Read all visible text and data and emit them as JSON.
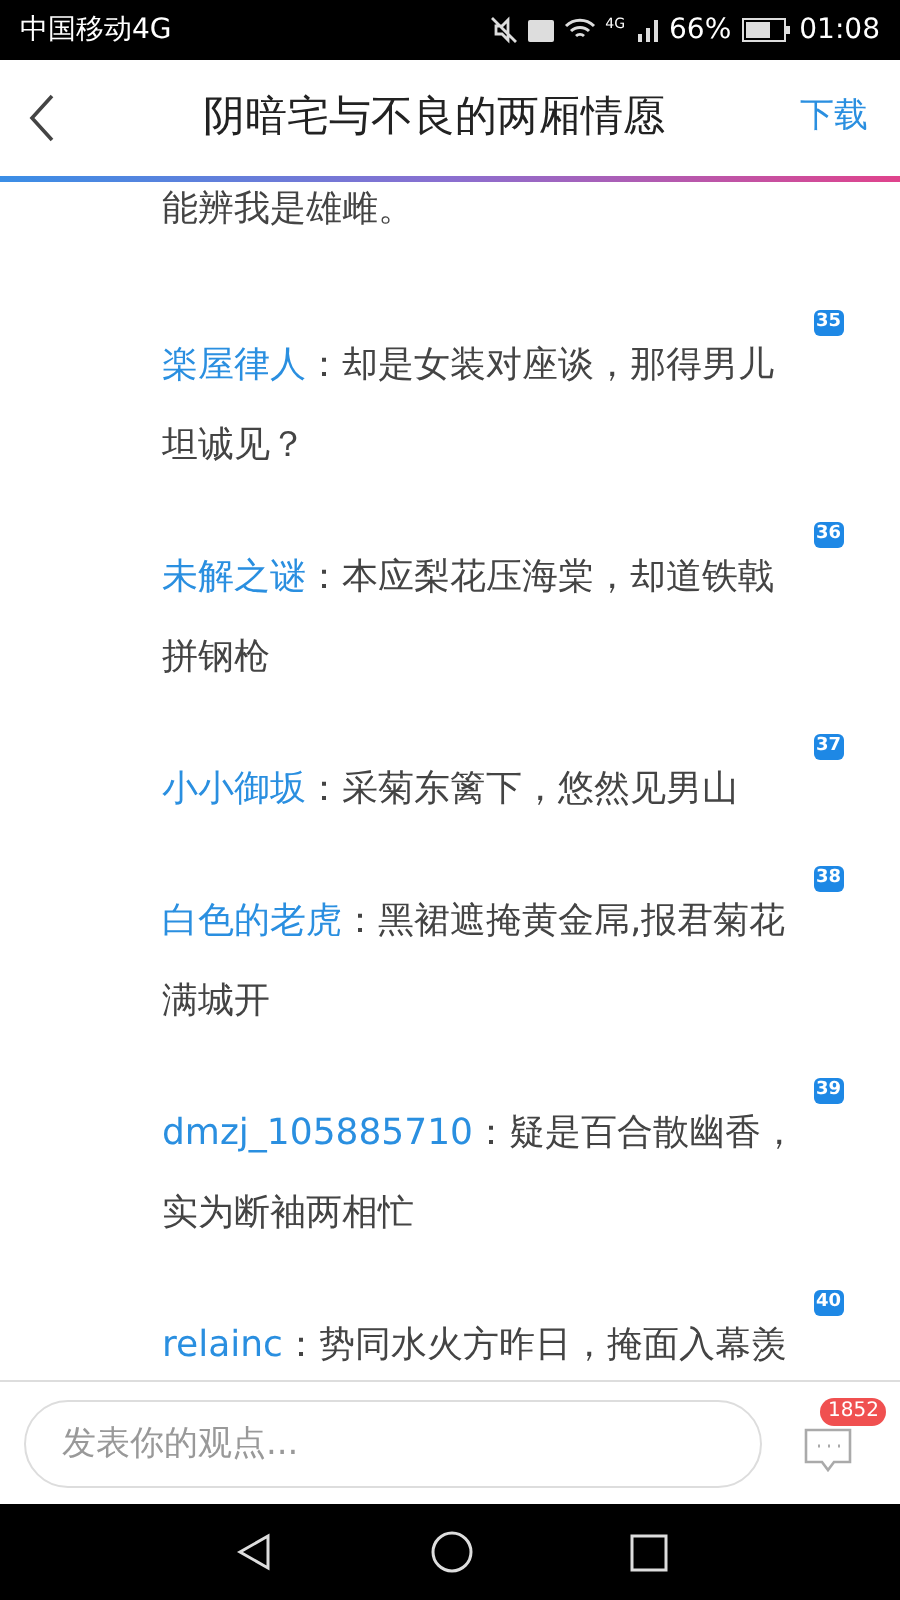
{
  "status_bar": {
    "carrier": "中国移动4G",
    "network": "4G",
    "battery": "66%",
    "time": "01:08"
  },
  "header": {
    "title": "阴暗宅与不良的两厢情愿",
    "action": "下载"
  },
  "comments": [
    {
      "kind": "continuation",
      "text": "能辨我是雄雌。"
    },
    {
      "kind": "comment",
      "user": "楽屋律人",
      "text": "：却是女装对座谈，那得男儿坦诚见？",
      "floor": "35"
    },
    {
      "kind": "comment",
      "user": "未解之谜",
      "text": "：本应梨花压海棠，却道铁戟拼钢枪",
      "floor": "36"
    },
    {
      "kind": "comment",
      "user": "小小御坂",
      "text": "：采菊东篱下，悠然见男山",
      "floor": "37"
    },
    {
      "kind": "comment",
      "user": "白色的老虎",
      "text": "：黑裙遮掩黄金屌,报君菊花满城开",
      "floor": "38"
    },
    {
      "kind": "comment",
      "user": "dmzj_105885710",
      "text": "：疑是百合散幽香，实为断袖两相忙",
      "floor": "39"
    },
    {
      "kind": "comment",
      "user": "relainc",
      "text": "：势同水火方昨日，掩面入幕羡",
      "floor": "40"
    }
  ],
  "composer": {
    "placeholder": "发表你的观点...",
    "comment_count": "1852"
  }
}
